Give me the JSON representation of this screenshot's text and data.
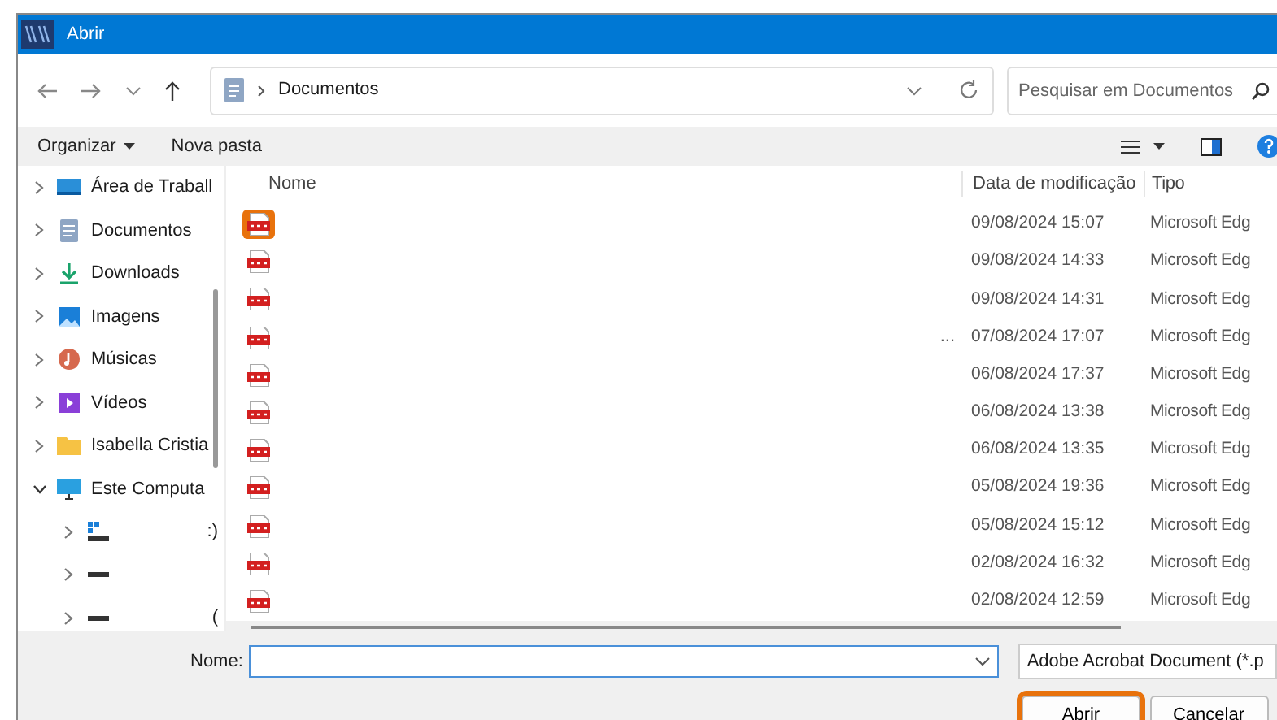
{
  "window": {
    "title": "Abrir"
  },
  "address": {
    "path": [
      "Documentos"
    ]
  },
  "search": {
    "placeholder": "Pesquisar em Documentos"
  },
  "toolbar": [
    {
      "label": "Organizar",
      "kind": "menu"
    },
    {
      "label": "Nova pasta",
      "kind": "button"
    }
  ],
  "sidebar": {
    "items": [
      {
        "label": "Área de Traball",
        "kind": "desktop",
        "expanded": false
      },
      {
        "label": "Documentos",
        "kind": "documents",
        "expanded": false
      },
      {
        "label": "Downloads",
        "kind": "download",
        "expanded": false
      },
      {
        "label": "Imagens",
        "kind": "pictures",
        "expanded": false
      },
      {
        "label": "Músicas",
        "kind": "music",
        "expanded": false
      },
      {
        "label": "Vídeos",
        "kind": "videos",
        "expanded": false
      },
      {
        "label": "Isabella Cristia",
        "kind": "folder",
        "expanded": false
      },
      {
        "label": "Este Computa",
        "kind": "computer",
        "expanded": true,
        "children": [
          {
            "label": ":)",
            "kind": "systemdrive",
            "expanded": false
          },
          {
            "kind": "drive",
            "expanded": false
          },
          {
            "label": "(",
            "kind": "drive",
            "expanded": false
          }
        ]
      }
    ]
  },
  "files": {
    "columns": [
      "Nome",
      "Data de modificação",
      "Tipo"
    ],
    "rows": [
      {
        "date": "09/08/2024 15:07",
        "type": "Microsoft Edg",
        "highlighted": true
      },
      {
        "date": "09/08/2024 14:33",
        "type": "Microsoft Edg",
        "highlighted": false
      },
      {
        "date": "09/08/2024 14:31",
        "type": "Microsoft Edg",
        "highlighted": false
      },
      {
        "name": "...",
        "date": "07/08/2024 17:07",
        "type": "Microsoft Edg",
        "highlighted": false
      },
      {
        "date": "06/08/2024 17:37",
        "type": "Microsoft Edg",
        "highlighted": false
      },
      {
        "date": "06/08/2024 13:38",
        "type": "Microsoft Edg",
        "highlighted": false
      },
      {
        "date": "06/08/2024 13:35",
        "type": "Microsoft Edg",
        "highlighted": false
      },
      {
        "date": "05/08/2024 19:36",
        "type": "Microsoft Edg",
        "highlighted": false
      },
      {
        "date": "05/08/2024 15:12",
        "type": "Microsoft Edg",
        "highlighted": false
      },
      {
        "date": "02/08/2024 16:32",
        "type": "Microsoft Edg",
        "highlighted": false
      },
      {
        "date": "02/08/2024 12:59",
        "type": "Microsoft Edg",
        "highlighted": false
      }
    ]
  },
  "filename": {
    "label": "Nome:"
  },
  "filetype": {
    "value": "Adobe Acrobat Document (*.p"
  },
  "buttons": [
    {
      "label": "Abrir",
      "highlighted": true
    },
    {
      "label": "Cancelar",
      "highlighted": false
    }
  ]
}
